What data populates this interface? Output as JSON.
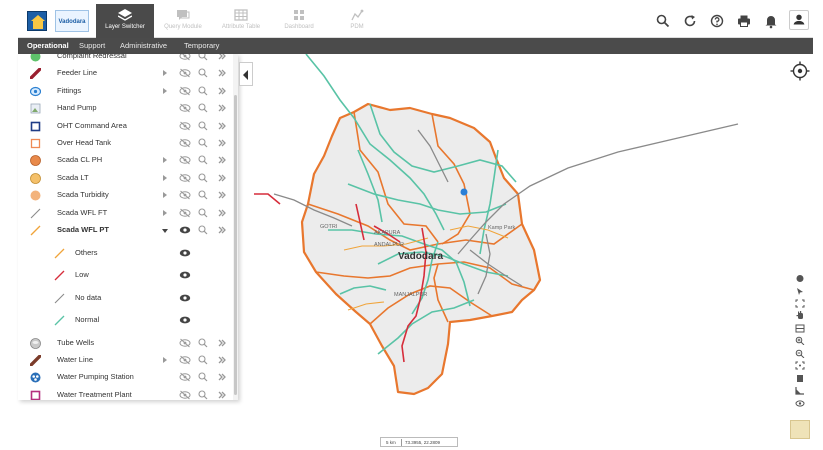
{
  "header": {
    "logo_text": "Vadodara",
    "tools": [
      {
        "label": "Layer Switcher",
        "icon": "layers-icon",
        "active": true
      },
      {
        "label": "Query Module",
        "icon": "chat-icon",
        "active": false
      },
      {
        "label": "Attribute Table",
        "icon": "table-icon",
        "active": false
      },
      {
        "label": "Dashboard",
        "icon": "dashboard-icon",
        "active": false
      },
      {
        "label": "PDM",
        "icon": "pdm-icon",
        "active": false
      }
    ],
    "right_icons": [
      "search-icon",
      "refresh-icon",
      "help-icon",
      "print-icon",
      "bell-icon",
      "user-icon"
    ]
  },
  "tabs": [
    {
      "label": "Operational",
      "active": true
    },
    {
      "label": "Support",
      "active": false
    },
    {
      "label": "Administrative",
      "active": false
    },
    {
      "label": "Temporary",
      "active": false
    }
  ],
  "layers": [
    {
      "label": "Complaint Redressal",
      "symbol": "dot-green"
    },
    {
      "label": "Feeder Line",
      "symbol": "line-maroon",
      "expandable": true
    },
    {
      "label": "Fittings",
      "symbol": "circle-blue",
      "expandable": true
    },
    {
      "label": "Hand Pump",
      "symbol": "image-broken"
    },
    {
      "label": "OHT Command Area",
      "symbol": "square-navy"
    },
    {
      "label": "Over Head Tank",
      "symbol": "square-orange"
    },
    {
      "label": "Scada CL PH",
      "symbol": "dot-orange",
      "expandable": true
    },
    {
      "label": "Scada LT",
      "symbol": "dot-yellow",
      "expandable": true
    },
    {
      "label": "Scada Turbidity",
      "symbol": "dot-peach",
      "expandable": true
    },
    {
      "label": "Scada WFL FT",
      "symbol": "line-gray",
      "expandable": true
    },
    {
      "label": "Scada WFL PT",
      "symbol": "line-orange",
      "expanded": true
    },
    {
      "label": "Others",
      "symbol": "line-orange",
      "sub": true
    },
    {
      "label": "Low",
      "symbol": "line-red",
      "sub": true
    },
    {
      "label": "No data",
      "symbol": "line-gray",
      "sub": true
    },
    {
      "label": "Normal",
      "symbol": "line-teal",
      "sub": true
    },
    {
      "label": "Tube Wells",
      "symbol": "well-gray"
    },
    {
      "label": "Water Line",
      "symbol": "line-brown",
      "expandable": true
    },
    {
      "label": "Water Pumping Station",
      "symbol": "pump-blue"
    },
    {
      "label": "Water Treatment Plant",
      "symbol": "square-magenta"
    }
  ],
  "map": {
    "city_label": "Vadodara",
    "places": [
      "GOTRI",
      "AKAPURA",
      "ANDALPUR",
      "MANJALPUR",
      "Kamp Park"
    ],
    "scale_text": "5 km",
    "coordinates": "73.3955, 22.2809"
  },
  "colors": {
    "toolbar_active": "#4a4a4a",
    "tabs_bg": "#4b4b4b",
    "boundary": "#e8772e",
    "pipeline": "#59c3a6",
    "low": "#d62d3b",
    "nodata": "#8a8a8a"
  }
}
